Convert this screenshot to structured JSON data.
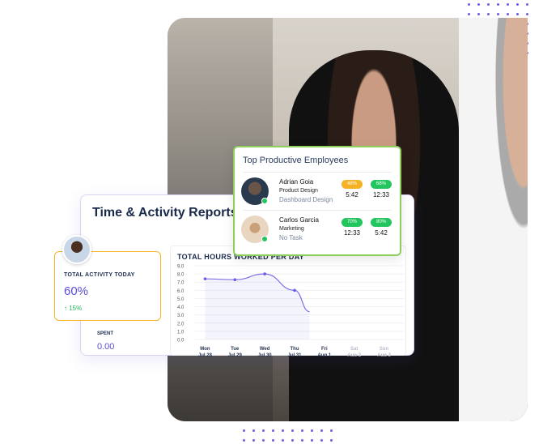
{
  "report": {
    "title": "Time & Activity Reports"
  },
  "activity": {
    "label": "TOTAL ACTIVITY TODAY",
    "value": "60%",
    "trend": "↑ 15%"
  },
  "spent": {
    "label": "SPENT",
    "value": "0.00"
  },
  "top_employees": {
    "title": "Top Productive Employees",
    "employees": [
      {
        "name": "Adrian Goia",
        "role": "Product Design",
        "task": "Dashboard Design",
        "stats": [
          {
            "pct": "48%",
            "time": "5:42",
            "color": "#f5b225"
          },
          {
            "pct": "68%",
            "time": "12:33",
            "color": "#22c55e"
          }
        ]
      },
      {
        "name": "Carlos Garcia",
        "role": "Marketing",
        "task": "No Task",
        "stats": [
          {
            "pct": "70%",
            "time": "12:33",
            "color": "#22c55e"
          },
          {
            "pct": "80%",
            "time": "5:42",
            "color": "#22c55e"
          }
        ]
      }
    ]
  },
  "colors": {
    "accent": "#5a4fd6",
    "orange": "#f5b225",
    "green": "#22c55e"
  },
  "chart_data": {
    "type": "area",
    "title": "TOTAL HOURS WORKED PER DAY",
    "categories": [
      [
        "Mon",
        "Jul 28"
      ],
      [
        "Tue",
        "Jul 29"
      ],
      [
        "Wed",
        "Jul 30"
      ],
      [
        "Thu",
        "Jul 31"
      ],
      [
        "Fri",
        "Aug 1"
      ],
      [
        "Sat",
        "Aug 2"
      ],
      [
        "Sun",
        "Aug 3"
      ]
    ],
    "values": [
      7.4,
      7.3,
      8.0,
      6.0,
      3.4,
      null,
      null
    ],
    "yticks": [
      "9.0",
      "8.0",
      "7.0",
      "6.0",
      "5.0",
      "4.0",
      "3.0",
      "2.0",
      "1.0",
      "0.0"
    ],
    "ylim": [
      0,
      9
    ],
    "grid": true
  }
}
